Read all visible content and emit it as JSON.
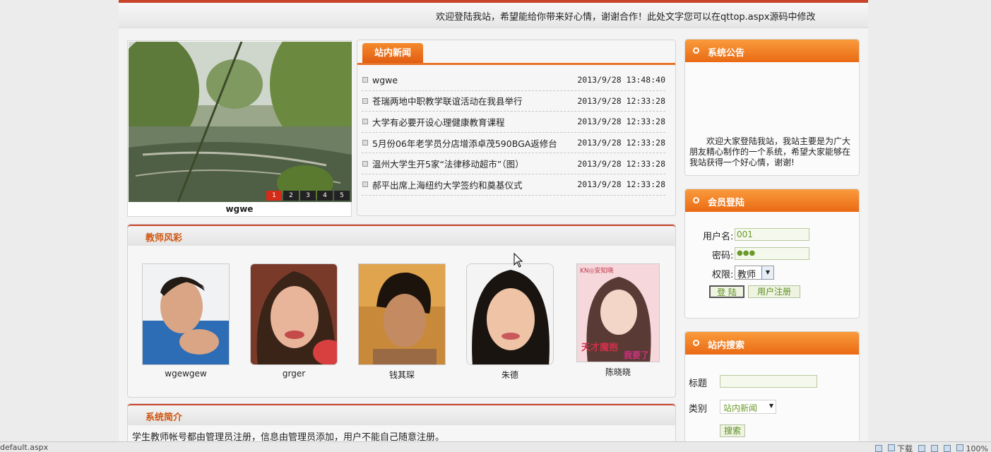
{
  "header": {
    "welcome_text": "欢迎登陆我站，希望能给你带来好心情，谢谢合作！此处文字您可以在qttop.aspx源码中修改"
  },
  "slideshow": {
    "caption": "wgwe",
    "pages": [
      "1",
      "2",
      "3",
      "4",
      "5"
    ],
    "active_page": "1"
  },
  "news": {
    "tab_label": "站内新闻",
    "items": [
      {
        "title": "wgwe",
        "date": "2013/9/28 13:48:40"
      },
      {
        "title": "苍瑞两地中职教学联谊活动在我县举行",
        "date": "2013/9/28 12:33:28"
      },
      {
        "title": "大学有必要开设心理健康教育课程",
        "date": "2013/9/28 12:33:28"
      },
      {
        "title": "5月份06年老学员分店增添卓茂590BGA返修台",
        "date": "2013/9/28 12:33:28"
      },
      {
        "title": "温州大学生开5家“法律移动超市”（图）",
        "date": "2013/9/28 12:33:28"
      },
      {
        "title": "郝平出席上海纽约大学签约和奠基仪式",
        "date": "2013/9/28 12:33:28"
      }
    ]
  },
  "teachers": {
    "title": "教师风彩",
    "items": [
      {
        "name": "wgewgew"
      },
      {
        "name": "grger"
      },
      {
        "name": "钱其琛"
      },
      {
        "name": "朱德"
      },
      {
        "name": "陈晓晓"
      }
    ],
    "poster_top": "KN◎安知晓",
    "poster_title": "天才魔抱",
    "poster_sub": "我要了"
  },
  "intro": {
    "title": "系统简介",
    "text": "学生教师帐号都由管理员注册，信息由管理员添加，用户不能自己随意注册。"
  },
  "notice": {
    "title": "系统公告",
    "text": "欢迎大家登陆我站，我站主要是为广大朋友精心制作的一个系统，希望大家能够在我站获得一个好心情，谢谢!"
  },
  "login": {
    "title": "会员登陆",
    "username_label": "用户名:",
    "username_value": "001",
    "password_label": "密码:",
    "password_value": "●●●",
    "role_label": "权限:",
    "role_value": "教师",
    "login_button": "登 陆",
    "register_button": "用户注册"
  },
  "search": {
    "title": "站内搜索",
    "title_label": "标题",
    "category_label": "类别",
    "category_value": "站内新闻",
    "search_button": "搜索"
  },
  "statusbar": {
    "url": "default.aspx",
    "download_label": "下载",
    "zoom": "100%"
  },
  "colors": {
    "accent": "#e8742a",
    "header_line": "#c8452b",
    "active_slide": "#d42c18"
  }
}
